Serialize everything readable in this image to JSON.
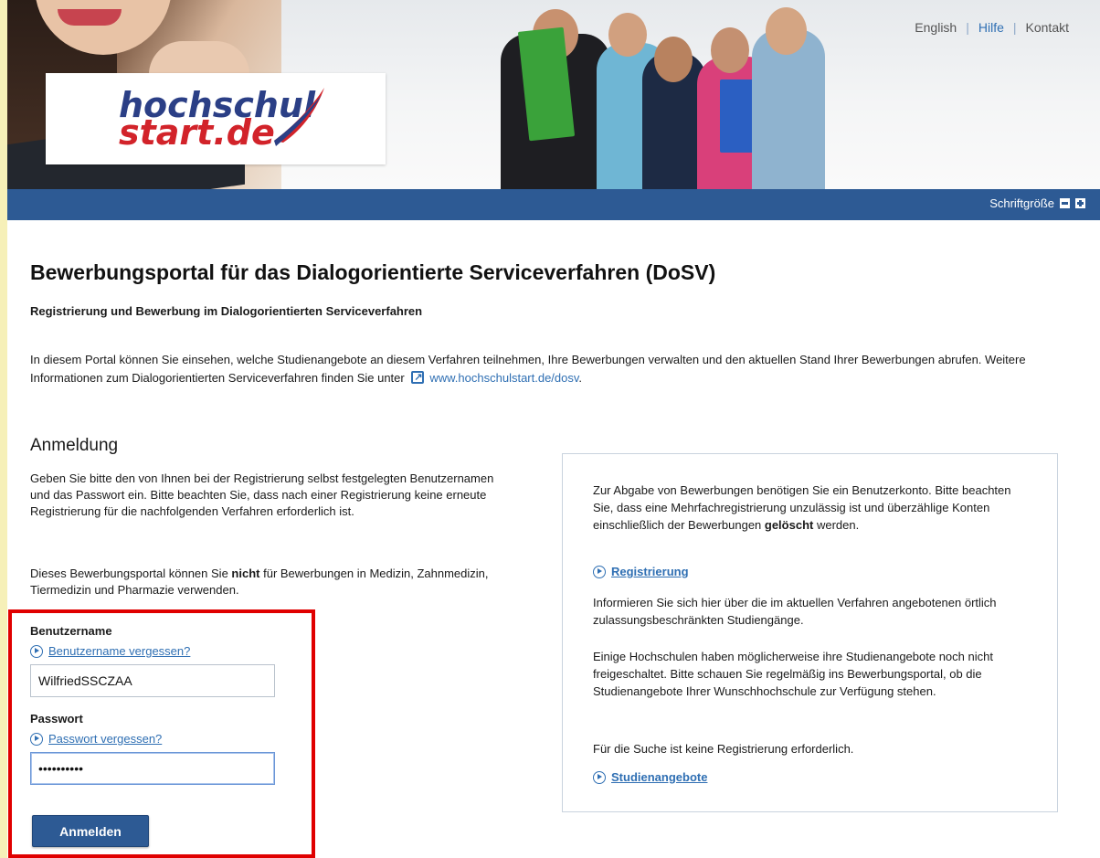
{
  "header": {
    "logo": {
      "line1": "hochschul",
      "line2": "start.de"
    },
    "links": [
      {
        "label": "English",
        "active": false
      },
      {
        "label": "Hilfe",
        "active": true
      },
      {
        "label": "Kontakt",
        "active": false
      }
    ]
  },
  "toolbar": {
    "font_size_label": "Schriftgröße",
    "decrease_icon": "minus-square-icon",
    "increase_icon": "plus-square-icon"
  },
  "main": {
    "title": "Bewerbungsportal für das Dialogorientierte Serviceverfahren (DoSV)",
    "subtitle": "Registrierung und Bewerbung im Dialogorientierten Serviceverfahren",
    "intro_text": "In diesem Portal können Sie einsehen, welche Studienangebote an diesem Verfahren teilnehmen, Ihre Bewerbungen verwalten und den aktuellen Stand Ihrer Bewerbungen abrufen. Weitere Informationen zum Dialogorientierten Serviceverfahren finden Sie unter",
    "intro_link": "www.hochschulstart.de/dosv",
    "intro_end": "."
  },
  "login": {
    "title": "Anmeldung",
    "description": "Geben Sie bitte den von Ihnen bei der Registrierung selbst festgelegten Benutzernamen und das Passwort ein. Bitte beachten Sie, dass nach einer Registrierung keine erneute Registrierung für die nachfolgenden Verfahren erforderlich ist.",
    "desc2_before": "Dieses Bewerbungsportal können Sie ",
    "desc2_bold": "nicht",
    "desc2_after": " für Bewerbungen in Medizin, Zahnmedizin, Tiermedizin und Pharmazie verwenden.",
    "username_label": "Benutzername",
    "username_forgot": "Benutzername vergessen?",
    "username_value": "WilfriedSSCZAA",
    "password_label": "Passwort",
    "password_forgot": "Passwort vergessen?",
    "password_value": "••••••••••",
    "submit_label": "Anmelden"
  },
  "info": {
    "p1_before": "Zur Abgabe von Bewerbungen benötigen Sie ein Benutzerkonto. Bitte beachten Sie, dass eine Mehrfachregistrierung unzulässig ist und überzählige Konten einschließlich der Bewerbungen ",
    "p1_bold": "gelöscht",
    "p1_after": " werden.",
    "register_link": "Registrierung",
    "p2": "Informieren Sie sich hier über die im aktuellen Verfahren angebotenen örtlich zulassungsbeschränkten Studiengänge.",
    "p3": "Einige Hochschulen haben möglicherweise ihre Studienangebote noch nicht freigeschaltet. Bitte schauen Sie regelmäßig ins Bewerbungsportal, ob die Studienangebote Ihrer Wunschhochschule zur Verfügung stehen.",
    "p4": "Für die Suche ist keine Registrierung erforderlich.",
    "courses_link": "Studienangebote"
  }
}
